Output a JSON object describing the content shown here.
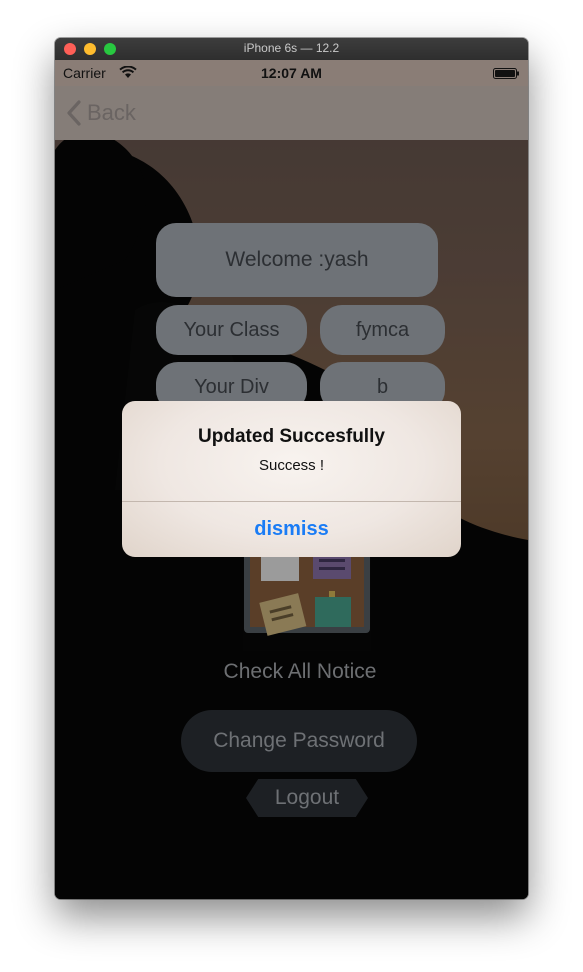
{
  "window": {
    "title": "iPhone 6s — 12.2"
  },
  "status_bar": {
    "carrier": "Carrier",
    "time": "12:07 AM"
  },
  "nav": {
    "back_label": "Back"
  },
  "profile": {
    "welcome": "Welcome :yash",
    "class_label": "Your Class",
    "class_value": "fymca",
    "div_label": "Your Div",
    "div_value": "b"
  },
  "actions": {
    "notice_label": "Check All Notice",
    "change_password": "Change Password",
    "logout": "Logout"
  },
  "alert": {
    "title": "Updated Succesfully",
    "message": "Success !",
    "action": "dismiss"
  },
  "colors": {
    "accent": "#1a7cf5"
  }
}
